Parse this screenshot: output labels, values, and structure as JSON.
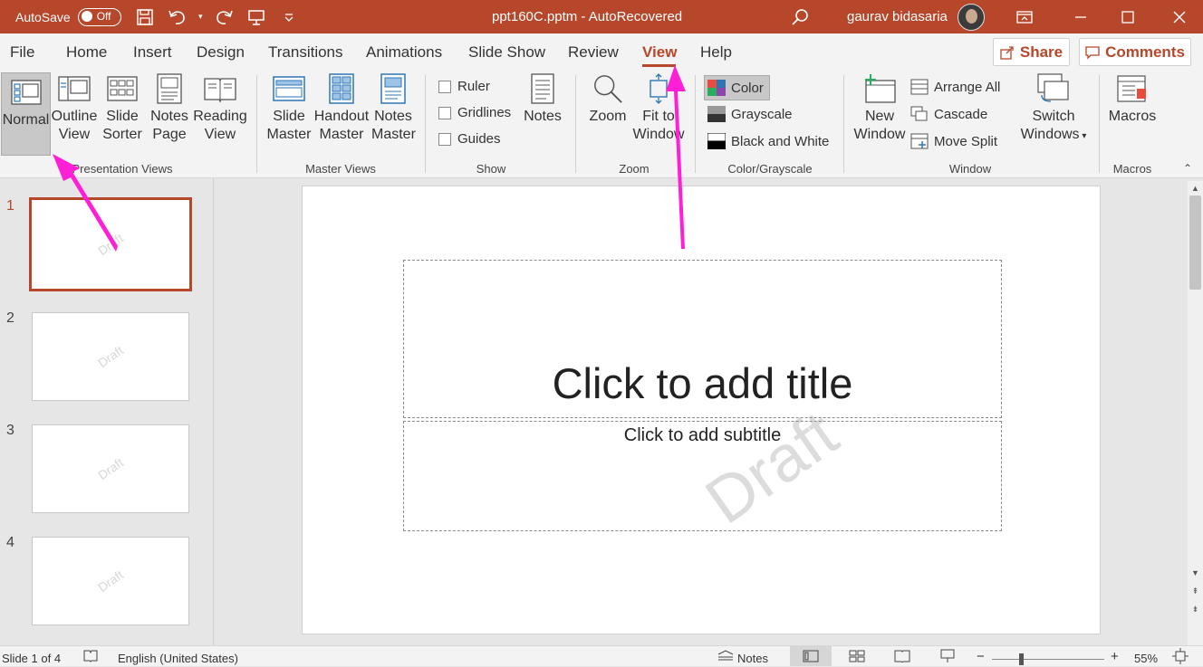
{
  "titlebar": {
    "autosave_label": "AutoSave",
    "autosave_state": "Off",
    "filename": "ppt160C.pptm  -  AutoRecovered",
    "user_name": "gaurav bidasaria"
  },
  "tabs": [
    "File",
    "Home",
    "Insert",
    "Design",
    "Transitions",
    "Animations",
    "Slide Show",
    "Review",
    "View",
    "Help"
  ],
  "active_tab": "View",
  "share_label": "Share",
  "comments_label": "Comments",
  "ribbon": {
    "presentation_views": {
      "group": "Presentation Views",
      "normal": "Normal",
      "outline_1": "Outline",
      "outline_2": "View",
      "sorter_1": "Slide",
      "sorter_2": "Sorter",
      "notes_1": "Notes",
      "notes_2": "Page",
      "reading_1": "Reading",
      "reading_2": "View"
    },
    "master_views": {
      "group": "Master Views",
      "slide_1": "Slide",
      "slide_2": "Master",
      "handout_1": "Handout",
      "handout_2": "Master",
      "notes_1": "Notes",
      "notes_2": "Master"
    },
    "show": {
      "group": "Show",
      "ruler": "Ruler",
      "gridlines": "Gridlines",
      "guides": "Guides",
      "notes": "Notes"
    },
    "zoom": {
      "group": "Zoom",
      "zoom": "Zoom",
      "fit_1": "Fit to",
      "fit_2": "Window"
    },
    "color": {
      "group": "Color/Grayscale",
      "color": "Color",
      "grayscale": "Grayscale",
      "bw": "Black and White"
    },
    "window": {
      "group": "Window",
      "new_1": "New",
      "new_2": "Window",
      "arrange": "Arrange All",
      "cascade": "Cascade",
      "split": "Move Split",
      "switch_1": "Switch",
      "switch_2": "Windows"
    },
    "macros": {
      "group": "Macros",
      "macros": "Macros"
    }
  },
  "slides": [
    {
      "num": "1",
      "watermark": "Draft"
    },
    {
      "num": "2",
      "watermark": "Draft"
    },
    {
      "num": "3",
      "watermark": "Draft"
    },
    {
      "num": "4",
      "watermark": "Draft"
    }
  ],
  "current_slide": {
    "title_placeholder": "Click to add title",
    "subtitle_placeholder": "Click to add subtitle",
    "watermark": "Draft"
  },
  "statusbar": {
    "slide_info": "Slide 1 of 4",
    "language": "English (United States)",
    "notes": "Notes",
    "zoom_minus": "−",
    "zoom_plus": "+",
    "zoom_level": "55%"
  },
  "colors": {
    "accent": "#b7472a",
    "annotation_arrow": "#ff1fd7"
  }
}
